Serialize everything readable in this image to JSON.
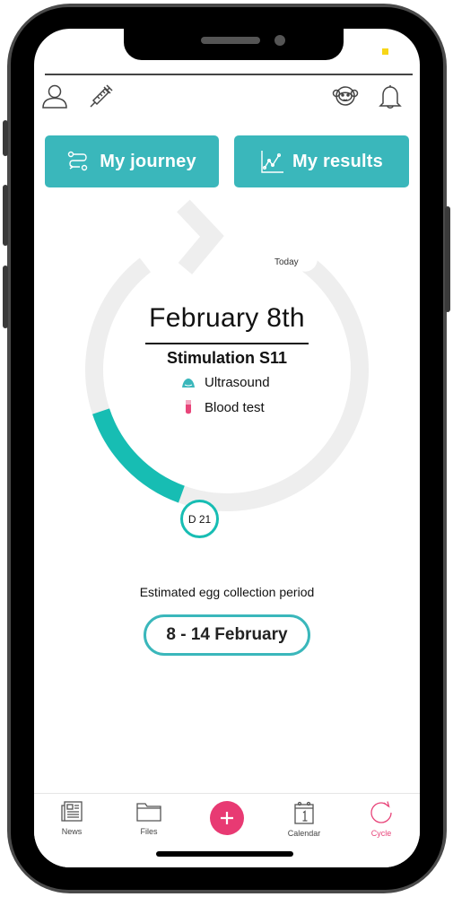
{
  "header": {
    "icons": {
      "profile": "user-icon",
      "medication": "syringe-icon",
      "companion": "monkey-face-icon",
      "notifications": "bell-icon"
    }
  },
  "actions": {
    "journey": {
      "label": "My journey",
      "icon": "route-icon"
    },
    "results": {
      "label": "My results",
      "icon": "line-chart-icon"
    }
  },
  "cycle": {
    "today_label": "Today",
    "date": "February 8th",
    "phase": "Stimulation S11",
    "appointments": [
      {
        "label": "Ultrasound",
        "icon": "ultrasound-icon",
        "color": "#3ab7bb"
      },
      {
        "label": "Blood test",
        "icon": "test-tube-icon",
        "color": "#e8457a"
      }
    ],
    "day_badge": "D 21",
    "progress_fraction": 0.18,
    "track_color": "#eeeeee",
    "progress_color": "#17bdb3"
  },
  "egg_collection": {
    "label": "Estimated egg collection period",
    "range": "8 - 14 February"
  },
  "tabbar": {
    "items": [
      {
        "label": "News",
        "icon": "newspaper-icon",
        "active": false
      },
      {
        "label": "Files",
        "icon": "folder-icon",
        "active": false
      },
      {
        "label": "Calendar",
        "icon": "calendar-icon",
        "active": false
      },
      {
        "label": "Cycle",
        "icon": "cycle-icon",
        "active": true
      }
    ],
    "fab_icon": "plus-icon",
    "accent": "#e8457a"
  },
  "colors": {
    "primary": "#3ab7bb",
    "accent": "#e83a73"
  }
}
